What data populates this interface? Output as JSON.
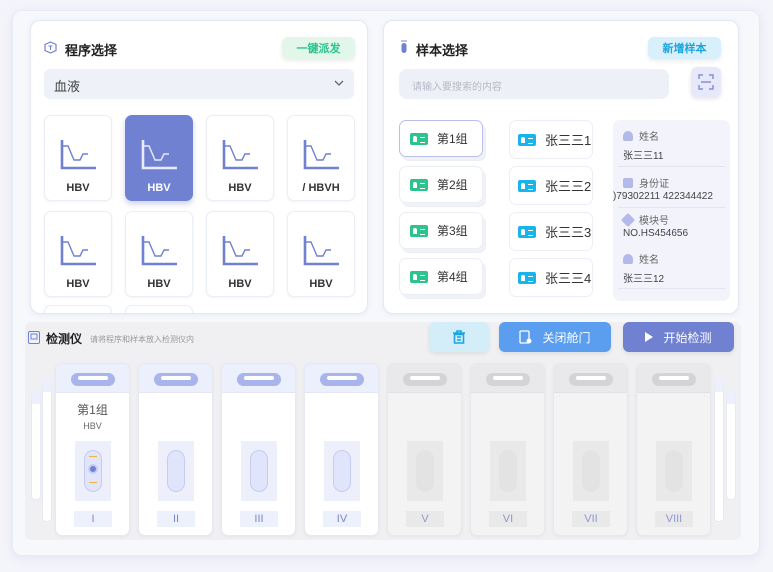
{
  "program": {
    "title": "程序选择",
    "dispatch_button": "一键派发",
    "category": "血液",
    "cards": [
      {
        "label": "HBV",
        "selected": false
      },
      {
        "label": "HBV",
        "selected": true
      },
      {
        "label": "HBV",
        "selected": false
      },
      {
        "label": "/  HBVH",
        "selected": false
      },
      {
        "label": "HBV",
        "selected": false
      },
      {
        "label": "HBV",
        "selected": false
      },
      {
        "label": "HBV",
        "selected": false
      },
      {
        "label": "HBV",
        "selected": false
      }
    ]
  },
  "sample": {
    "title": "样本选择",
    "add_button": "新增样本",
    "search_placeholder": "请输入要搜索的内容",
    "groups": [
      "第1组",
      "第2组",
      "第3组",
      "第4组"
    ],
    "persons": [
      "张三三1",
      "张三三2",
      "张三三3",
      "张三三4"
    ],
    "info": {
      "name_label": "姓名",
      "name1": "张三三11",
      "id_label": "身份证",
      "id_value": ")79302211  422344422",
      "module_label": "模块号",
      "module_value": "NO.HS454656",
      "name_label2": "姓名",
      "name2": "张三三12"
    }
  },
  "detector": {
    "title": "检测仪",
    "hint": "请将程序和样本放入检测仪内",
    "close_door": "关闭舱门",
    "start": "开始检测",
    "slots": [
      {
        "num": "I",
        "group": "第1组",
        "program": "HBV",
        "active": true
      },
      {
        "num": "II",
        "active": true
      },
      {
        "num": "III",
        "active": true
      },
      {
        "num": "IV",
        "active": true
      },
      {
        "num": "V",
        "active": false
      },
      {
        "num": "VI",
        "active": false
      },
      {
        "num": "VII",
        "active": false
      },
      {
        "num": "VIII",
        "active": false
      }
    ]
  },
  "colors": {
    "accent": "#7181d2",
    "green": "#2cc38d",
    "cyan": "#18b4ea",
    "blue_btn": "#5b9ef0"
  }
}
